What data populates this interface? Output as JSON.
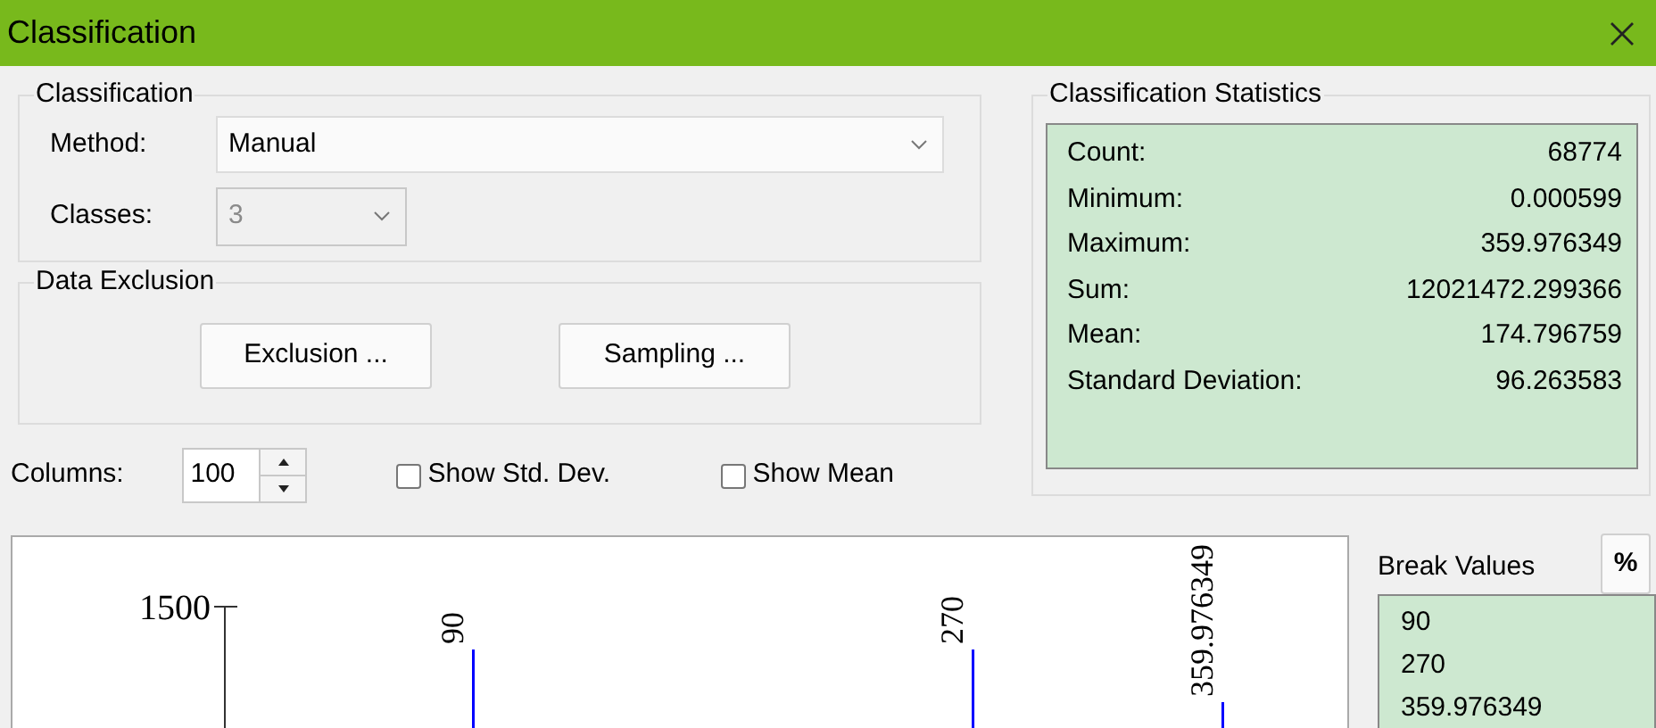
{
  "window": {
    "title": "Classification"
  },
  "classification": {
    "title": "Classification",
    "method": {
      "label": "Method:",
      "value": "Manual"
    },
    "classes": {
      "label": "Classes:",
      "value": "3",
      "disabled": true
    }
  },
  "data_exclusion": {
    "title": "Data Exclusion",
    "buttons": [
      "Exclusion ...",
      "Sampling ..."
    ]
  },
  "columns": {
    "label": "Columns:",
    "value": "100"
  },
  "options": [
    {
      "label": "Show Std. Dev.",
      "checked": false
    },
    {
      "label": "Show Mean",
      "checked": false
    }
  ],
  "statistics": {
    "title": "Classification Statistics",
    "rows": [
      {
        "label": "Count:",
        "value": "68774"
      },
      {
        "label": "Minimum:",
        "value": "0.000599"
      },
      {
        "label": "Maximum:",
        "value": "359.976349"
      },
      {
        "label": "Sum:",
        "value": "12021472.299366"
      },
      {
        "label": "Mean:",
        "value": "174.796759"
      },
      {
        "label": "Standard Deviation:",
        "value": "96.263583"
      }
    ]
  },
  "histogram": {
    "y_tick": "1500",
    "breaks": [
      {
        "label": "90"
      },
      {
        "label": "270"
      },
      {
        "label": "359.976349"
      }
    ]
  },
  "break_values": {
    "title": "Break Values",
    "percent_button": "%",
    "values": [
      "90",
      "270",
      "359.976349"
    ]
  }
}
